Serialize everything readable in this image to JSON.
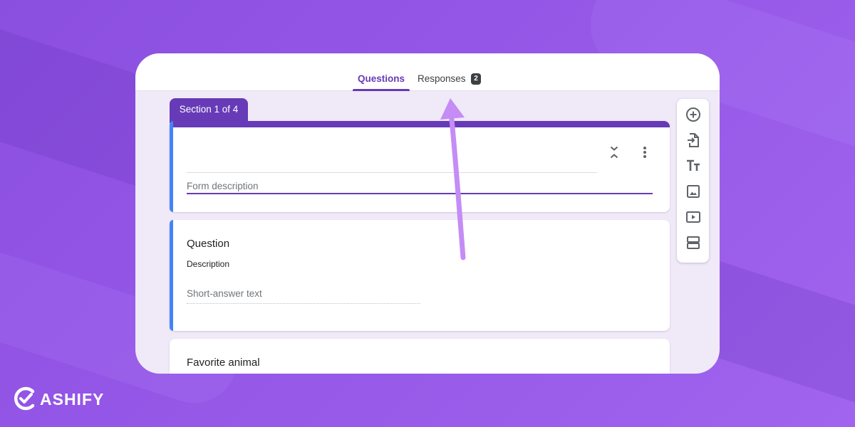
{
  "tabs": {
    "questions_label": "Questions",
    "responses_label": "Responses",
    "responses_count": "2"
  },
  "section": {
    "label": "Section 1 of 4"
  },
  "header_card": {
    "description_placeholder": "Form description"
  },
  "questions": [
    {
      "title": "Question",
      "description": "Description",
      "answer_placeholder": "Short-answer text"
    },
    {
      "title": "Favorite animal"
    }
  ],
  "toolbar": {
    "items": [
      "add-question-icon",
      "import-questions-icon",
      "add-title-icon",
      "add-image-icon",
      "add-video-icon",
      "add-section-icon"
    ]
  },
  "branding": {
    "logo_text": "ASHIFY"
  },
  "colors": {
    "background": "#9456e6",
    "form_accent": "#673ab7",
    "question_accent": "#4285f4",
    "arrow": "#c58cf5"
  }
}
